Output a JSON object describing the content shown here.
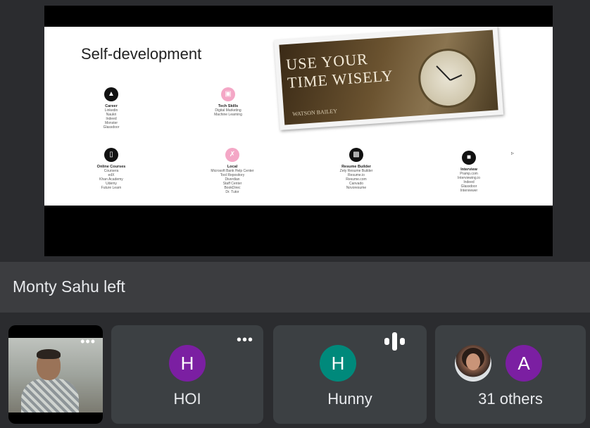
{
  "slide": {
    "title": "Self-development",
    "quote_line1": "USE YOUR",
    "quote_line2": "TIME WISELY",
    "quote_author": "WATSON BAILEY",
    "items": [
      {
        "title": "Career",
        "lines": [
          "Linkedin",
          "Naukri",
          "Indeed",
          "Monster",
          "Glassdoor"
        ],
        "icon": "graduation-cap-icon"
      },
      {
        "title": "Tech Skills",
        "lines": [
          "Digital Marketing",
          "Machine Learning"
        ],
        "icon": "monitor-icon"
      },
      {
        "title": "Online Courses",
        "lines": [
          "Coursera",
          "edX",
          "Khan Academy",
          "Udemy",
          "Future Learn"
        ],
        "icon": "book-icon"
      },
      {
        "title": "Local",
        "lines": [
          "Microsoft Bank Help Center",
          "Tool Repository",
          "Diverdian",
          "Staff Center",
          "BookDirec",
          "Dr. Tutor"
        ],
        "icon": "tools-icon"
      },
      {
        "title": "Resume Builder",
        "lines": [
          "Zety Resume Builder",
          "Resume.io",
          "Resume.com",
          "Canvado",
          "Novoresume"
        ],
        "icon": "printer-icon"
      },
      {
        "title": "Interview",
        "lines": [
          "Pramp.com",
          "Interviewing.io",
          "Indeed",
          "Glassdoor",
          "Interviewer"
        ],
        "icon": "chat-icon"
      }
    ]
  },
  "notification": {
    "text": "Monty Sahu left"
  },
  "participants": [
    {
      "name": "HOI",
      "initial": "H",
      "color": "#7b1fa2"
    },
    {
      "name": "Hunny",
      "initial": "H",
      "color": "#00897b"
    },
    {
      "name": "31 others",
      "initial": "A",
      "color": "#7b1fa2"
    }
  ],
  "self_tile": {
    "more_icon": "more-horizontal-icon"
  },
  "colors": {
    "background": "#2b2c2f",
    "tile": "#3c4043",
    "notice": "#3c3d40"
  }
}
